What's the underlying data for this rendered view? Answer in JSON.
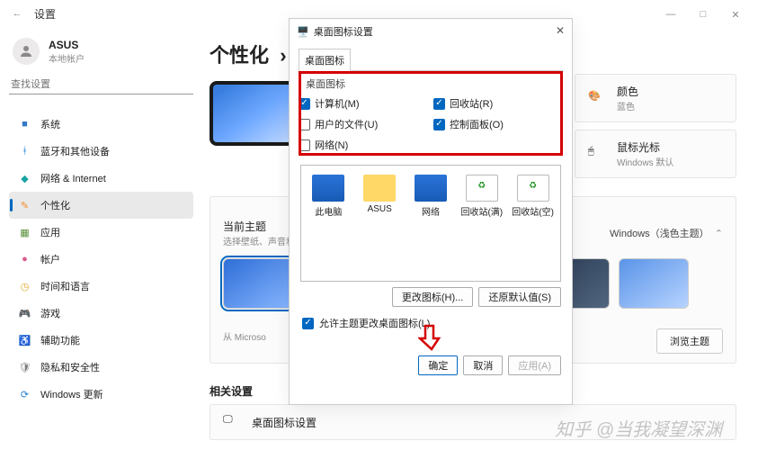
{
  "window": {
    "title": "设置",
    "controls": {
      "min": "—",
      "max": "□",
      "close": "✕"
    }
  },
  "account": {
    "name": "ASUS",
    "sub": "本地帐户"
  },
  "search": {
    "placeholder": "查找设置"
  },
  "nav": [
    {
      "icon": "#3178c6",
      "label": "系统",
      "shape": "rect"
    },
    {
      "icon": "#1f7fd1",
      "label": "蓝牙和其他设备",
      "shape": "bt"
    },
    {
      "icon": "#1aa3a3",
      "label": "网络 & Internet",
      "shape": "wifi"
    },
    {
      "icon": "#f28b2a",
      "label": "个性化",
      "shape": "pen",
      "active": true
    },
    {
      "icon": "#5b8f3d",
      "label": "应用",
      "shape": "grid"
    },
    {
      "icon": "#d85a8f",
      "label": "帐户",
      "shape": "user"
    },
    {
      "icon": "#e0a520",
      "label": "时间和语言",
      "shape": "clock"
    },
    {
      "icon": "#4ea744",
      "label": "游戏",
      "shape": "game"
    },
    {
      "icon": "#2f6fb8",
      "label": "辅助功能",
      "shape": "acc"
    },
    {
      "icon": "#7a7a7a",
      "label": "隐私和安全性",
      "shape": "shield"
    },
    {
      "icon": "#1f7fd1",
      "label": "Windows 更新",
      "shape": "upd"
    }
  ],
  "main": {
    "title": "个性化",
    "right_pills": [
      {
        "title": "颜色",
        "sub": "蓝色"
      },
      {
        "title": "鼠标光标",
        "sub": "Windows 默认"
      }
    ],
    "theme_section": {
      "title": "当前主题",
      "sub": "选择壁纸、声音和颜",
      "mode": "Windows（浅色主题）"
    },
    "from": "从 Microso",
    "browse": "浏览主题",
    "related": "相关设置",
    "related_item": "桌面图标设置"
  },
  "dialog": {
    "title": "桌面图标设置",
    "tab": "桌面图标",
    "group": "桌面图标",
    "checks": [
      {
        "label": "计算机(M)",
        "checked": true
      },
      {
        "label": "回收站(R)",
        "checked": true
      },
      {
        "label": "用户的文件(U)",
        "checked": false
      },
      {
        "label": "控制面板(O)",
        "checked": true
      },
      {
        "label": "网络(N)",
        "checked": false
      }
    ],
    "icons": [
      "此电脑",
      "ASUS",
      "网络",
      "回收站(满)",
      "回收站(空)"
    ],
    "change": "更改图标(H)...",
    "restore": "还原默认值(S)",
    "allow": "允许主题更改桌面图标(L)",
    "ok": "确定",
    "cancel": "取消",
    "apply": "应用(A)"
  },
  "watermark": "知乎 @当我凝望深渊"
}
